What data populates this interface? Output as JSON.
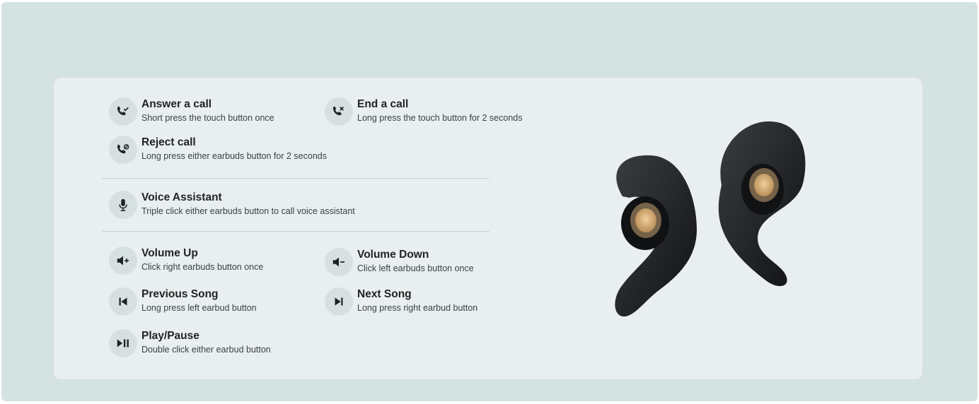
{
  "controls": {
    "answer_call": {
      "title": "Answer a call",
      "desc": "Short press the touch button once",
      "icon": "phone-answer-icon"
    },
    "end_call": {
      "title": "End a call",
      "desc": "Long press the touch button for 2 seconds",
      "icon": "phone-end-icon"
    },
    "reject_call": {
      "title": "Reject call",
      "desc": "Long press either earbuds button for 2 seconds",
      "icon": "phone-reject-icon"
    },
    "voice_assistant": {
      "title": "Voice Assistant",
      "desc": "Triple click either earbuds button to call voice assistant",
      "icon": "microphone-icon"
    },
    "volume_up": {
      "title": "Volume Up",
      "desc": "Click right earbuds button once",
      "icon": "volume-up-icon"
    },
    "volume_down": {
      "title": "Volume Down",
      "desc": "Click left earbuds button once",
      "icon": "volume-down-icon"
    },
    "previous_song": {
      "title": "Previous Song",
      "desc": "Long press left earbud button",
      "icon": "previous-track-icon"
    },
    "next_song": {
      "title": "Next Song",
      "desc": "Long press right earbud button",
      "icon": "next-track-icon"
    },
    "play_pause": {
      "title": "Play/Pause",
      "desc": "Double click either earbud button",
      "icon": "play-pause-icon"
    }
  },
  "colors": {
    "outer_background": "#d5e2e2",
    "card_background": "#e9efef",
    "icon_circle": "#d7e0e0",
    "text_primary": "#1e2222",
    "earbud_body": "#1c1e20",
    "earbud_speaker": "#d9b07a"
  }
}
